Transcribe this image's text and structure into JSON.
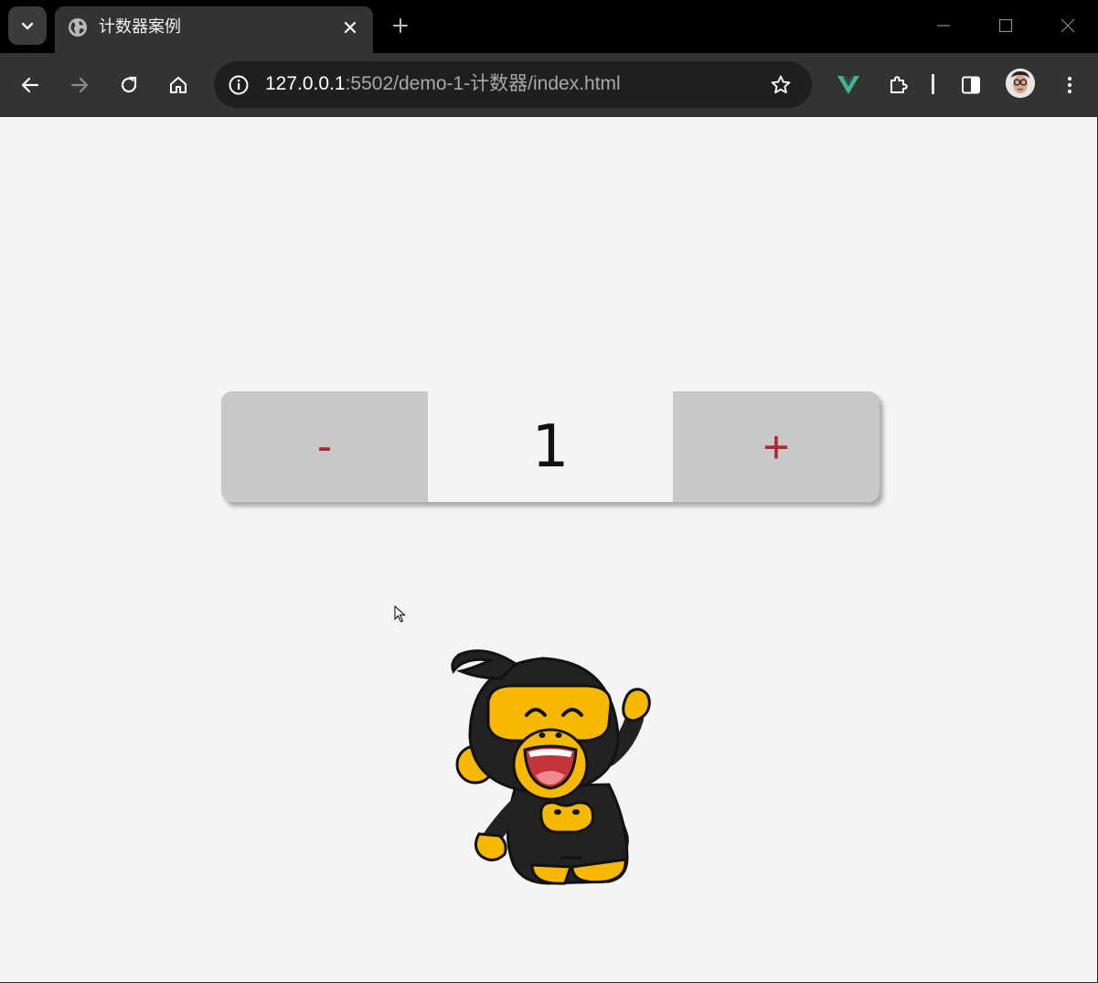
{
  "tab": {
    "title": "计数器案例",
    "favicon": "globe-icon"
  },
  "omnibox": {
    "url_host": "127.0.0.1",
    "url_path": ":5502/demo-1-计数器/index.html"
  },
  "counter": {
    "minus_label": "-",
    "value": "1",
    "plus_label": "+"
  },
  "colors": {
    "accent_red": "#b0282b",
    "button_gray": "#c8c8c8",
    "page_bg": "#f4f4f4",
    "chrome_dark": "#333333"
  }
}
